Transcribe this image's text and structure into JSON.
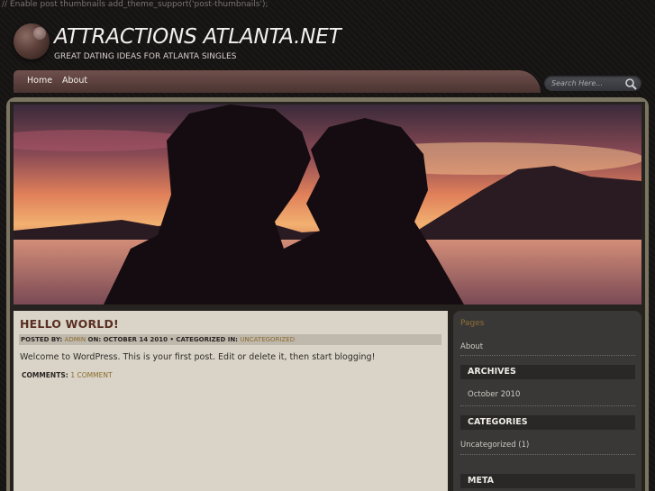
{
  "header": {
    "code_note": "// Enable post thumbnails add_theme_support('post-thumbnails');",
    "site_title": "ATTRACTIONS ATLANTA.NET",
    "tagline": "GREAT DATING IDEAS FOR ATLANTA SINGLES"
  },
  "nav": {
    "items": [
      {
        "label": "Home"
      },
      {
        "label": "About"
      }
    ]
  },
  "search": {
    "placeholder": "Search Here..."
  },
  "post": {
    "title": "HELLO WORLD!",
    "meta_posted_by_label": "POSTED BY:",
    "meta_author": "ADMIN",
    "meta_on_label": "ON: OCTOBER 14 2010 • CATEGORIZED IN:",
    "meta_category": "UNCATEGORIZED",
    "body": "Welcome to WordPress. This is your first post. Edit or delete it, then start blogging!",
    "comments_label": "COMMENTS:",
    "comments_link": "1 COMMENT"
  },
  "sidebar": {
    "pages_heading": "Pages",
    "pages": [
      "About"
    ],
    "archives_heading": "ARCHIVES",
    "archives": [
      "October 2010"
    ],
    "categories_heading": "CATEGORIES",
    "categories": [
      "Uncategorized (1)"
    ],
    "meta_heading": "META"
  },
  "colors": {
    "background": "#161313",
    "nav_bar": "#5e4340",
    "post_bg": "#d9d4c7",
    "post_title": "#5a2e22",
    "link": "#8b6a2d",
    "sidebar_bg": "#3a3836",
    "frame": "#7b7460"
  }
}
